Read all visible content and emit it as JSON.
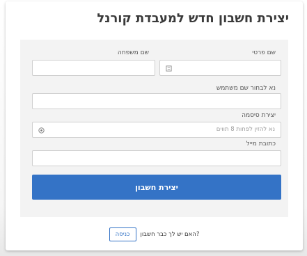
{
  "page": {
    "title": "יצירת חשבון חדש למעבדת קורנל"
  },
  "form": {
    "first_name_label": "שם פרטי",
    "last_name_label": "שם משפחה",
    "username_label": "נא לבחור שם משתמש",
    "password_label": "יצירת סיסמה",
    "password_placeholder": "נא להזין לפחות 8 תווים",
    "email_label": "כתובת מייל",
    "submit_label": "יצירת חשבון"
  },
  "footer": {
    "question": "?האם יש לך כבר חשבון",
    "login_label": "כניסה"
  },
  "colors": {
    "accent": "#3473c6",
    "panel": "#f3f3f3"
  },
  "icons": {
    "first_name_field_icon": "id-card-icon",
    "password_toggle_icon": "eye-icon"
  }
}
